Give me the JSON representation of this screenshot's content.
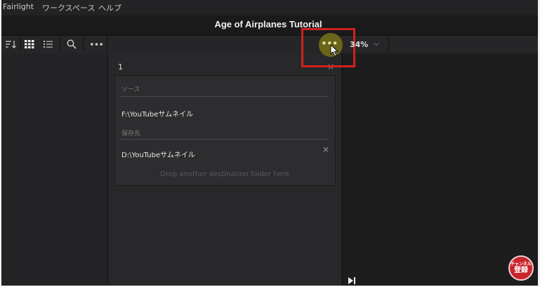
{
  "menu": {
    "items": [
      "Fairlight",
      "ワークスペース",
      "ヘルプ"
    ]
  },
  "project": {
    "title": "Age of Airplanes Tutorial"
  },
  "toolbar": {
    "icons": [
      "sort-icon",
      "grid-view-icon",
      "list-view-icon",
      "search-icon",
      "more-icon"
    ],
    "more_glyph": "•••",
    "zoom_label": "34%",
    "zoom_chevron": "⌵"
  },
  "clone_card": {
    "number": "1",
    "source_label": "ソース",
    "source_path": "F:\\YouTubeサムネイル",
    "destination_label": "保存先",
    "destination_path": "D:\\YouTubeサムネイル",
    "remove_glyph": "×",
    "drop_hint": "Drop another destination folder here"
  },
  "overlay": {
    "highlight_color": "#d2201f",
    "subscribe_badge_small": "チャンネル",
    "subscribe_badge": "登録"
  },
  "colors": {
    "background": "#1c1c1e",
    "panel": "#28282a",
    "card": "#2d2d2f",
    "accent_red": "#c8242b"
  }
}
